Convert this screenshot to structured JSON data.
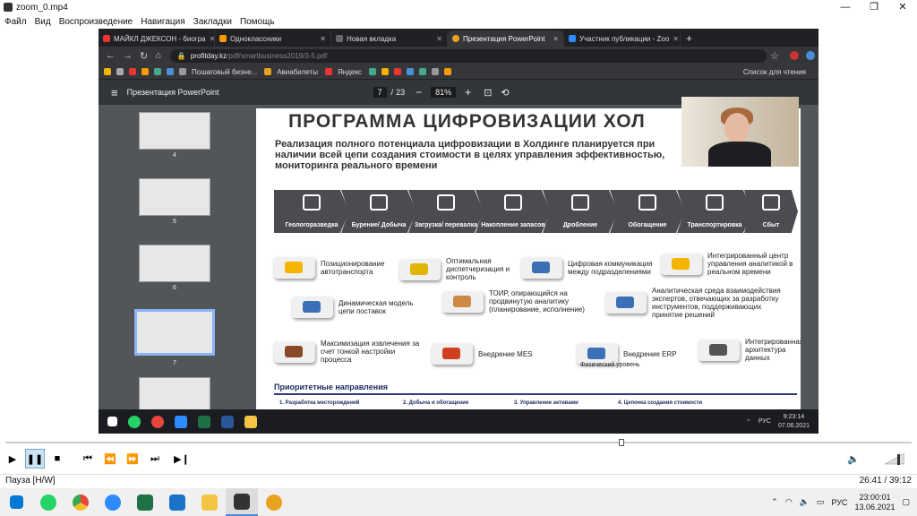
{
  "window": {
    "title": "zoom_0.mp4",
    "min": "—",
    "max": "❐",
    "close": "✕"
  },
  "menu": [
    "Файл",
    "Вид",
    "Воспроизведение",
    "Навигация",
    "Закладки",
    "Помощь"
  ],
  "browser": {
    "tabs": [
      {
        "label": "МАЙКЛ ДЖЕКСОН - биогра",
        "color": "#e33"
      },
      {
        "label": "Одноклассники",
        "color": "#f90"
      },
      {
        "label": "Новая вкладка",
        "color": "#888"
      },
      {
        "label": "Презентация PowerPoint",
        "color": "#e9a21f"
      },
      {
        "label": "Участник публикации - Zoo",
        "color": "#2d8cff"
      }
    ],
    "url_domain": "profitday.kz",
    "url_path": "/pdf/smartbusiness2019/3-5.pdf",
    "bookmarks": [
      "Пошаговый бизне...",
      "Авиабилеты",
      "Яндекс",
      "Список для чтения"
    ]
  },
  "pdf": {
    "title": "Презентация PowerPoint",
    "page": "7",
    "total": "23",
    "zoom": "81%",
    "thumb_numbers": [
      "4",
      "5",
      "6",
      "7"
    ]
  },
  "slide": {
    "title": "ПРОГРАММА ЦИФРОВИЗАЦИИ ХОЛ",
    "subtitle": "Реализация полного потенциала цифровизации в Холдинге планируется при наличии всей цепи создания стоимости в целях управления эффективностью, мониторинга реального времени",
    "chain": [
      "Геологоразведка",
      "Бурение/ Добыча",
      "Загрузка/ перевалка",
      "Накопление запасов",
      "Дробление",
      "Обогащение",
      "Транспортировка",
      "Сбыт"
    ],
    "items": [
      {
        "text": "Позиционирование автотранспорта",
        "color": "#f4b400"
      },
      {
        "text": "Оптимальная диспетчеризация и контроль",
        "color": "#e0b400"
      },
      {
        "text": "Цифровая коммуникация между подразделениями",
        "color": "#3b6fb6"
      },
      {
        "text": "Интегрированный центр управления аналитикой в реальном времени",
        "color": "#f4b400"
      },
      {
        "text": "Динамическая модель цепи поставок",
        "color": "#3b6fb6"
      },
      {
        "text": "ТОИР, опирающийся на продвинутую аналитику (планирование, исполнение)",
        "color": "#c84"
      },
      {
        "text": "Аналитическая среда взаимодействия экспертов, отвечающих за разработку инструментов, поддерживающих принятие решений",
        "color": "#3b6fb6"
      },
      {
        "text": "Максимизация извлечения за счет тонкой настройки процесса",
        "color": "#8a4a2a"
      },
      {
        "text": "Внедрение MES",
        "color": "#d04020"
      },
      {
        "text": "Внедрение ERP",
        "color": "#3b6fb6"
      },
      {
        "text": "Интегрированная архитектура данных",
        "color": "#555"
      }
    ],
    "physical_level": "Физический уровень",
    "priority_title": "Приоритетные направления",
    "priorities": [
      "1. Разработка месторождений",
      "2. Добыча и обогащение",
      "3. Управление активами",
      "4. Цепочка создания стоимости"
    ]
  },
  "inner_tray": {
    "lang": "РУС",
    "time": "9:23:14",
    "date": "07.06.2021"
  },
  "player": {
    "status": "Пауза [H/W]",
    "time": "26:41 / 39:12",
    "progress": 0.68
  },
  "taskbar": {
    "lang": "РУС",
    "time": "23:00:01",
    "date": "13.06.2021"
  }
}
